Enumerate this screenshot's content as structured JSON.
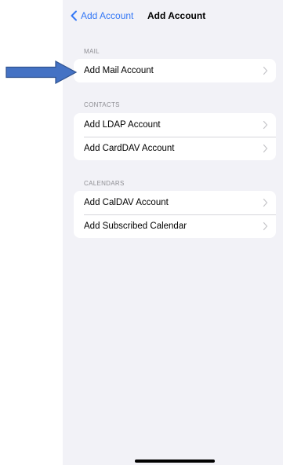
{
  "nav": {
    "back_label": "Add Account",
    "title": "Add Account"
  },
  "sections": {
    "mail": {
      "header": "MAIL",
      "items": [
        "Add Mail Account"
      ]
    },
    "contacts": {
      "header": "CONTACTS",
      "items": [
        "Add LDAP Account",
        "Add CardDAV Account"
      ]
    },
    "calendars": {
      "header": "CALENDARS",
      "items": [
        "Add CalDAV Account",
        "Add Subscribed Calendar"
      ]
    }
  },
  "icons": {
    "back": "chevron-left-icon",
    "row": "chevron-right-icon",
    "annotation": "arrow-right-icon"
  },
  "colors": {
    "accent": "#3478f6",
    "background": "#f2f2f7",
    "annotation_arrow": "#4472c4"
  }
}
